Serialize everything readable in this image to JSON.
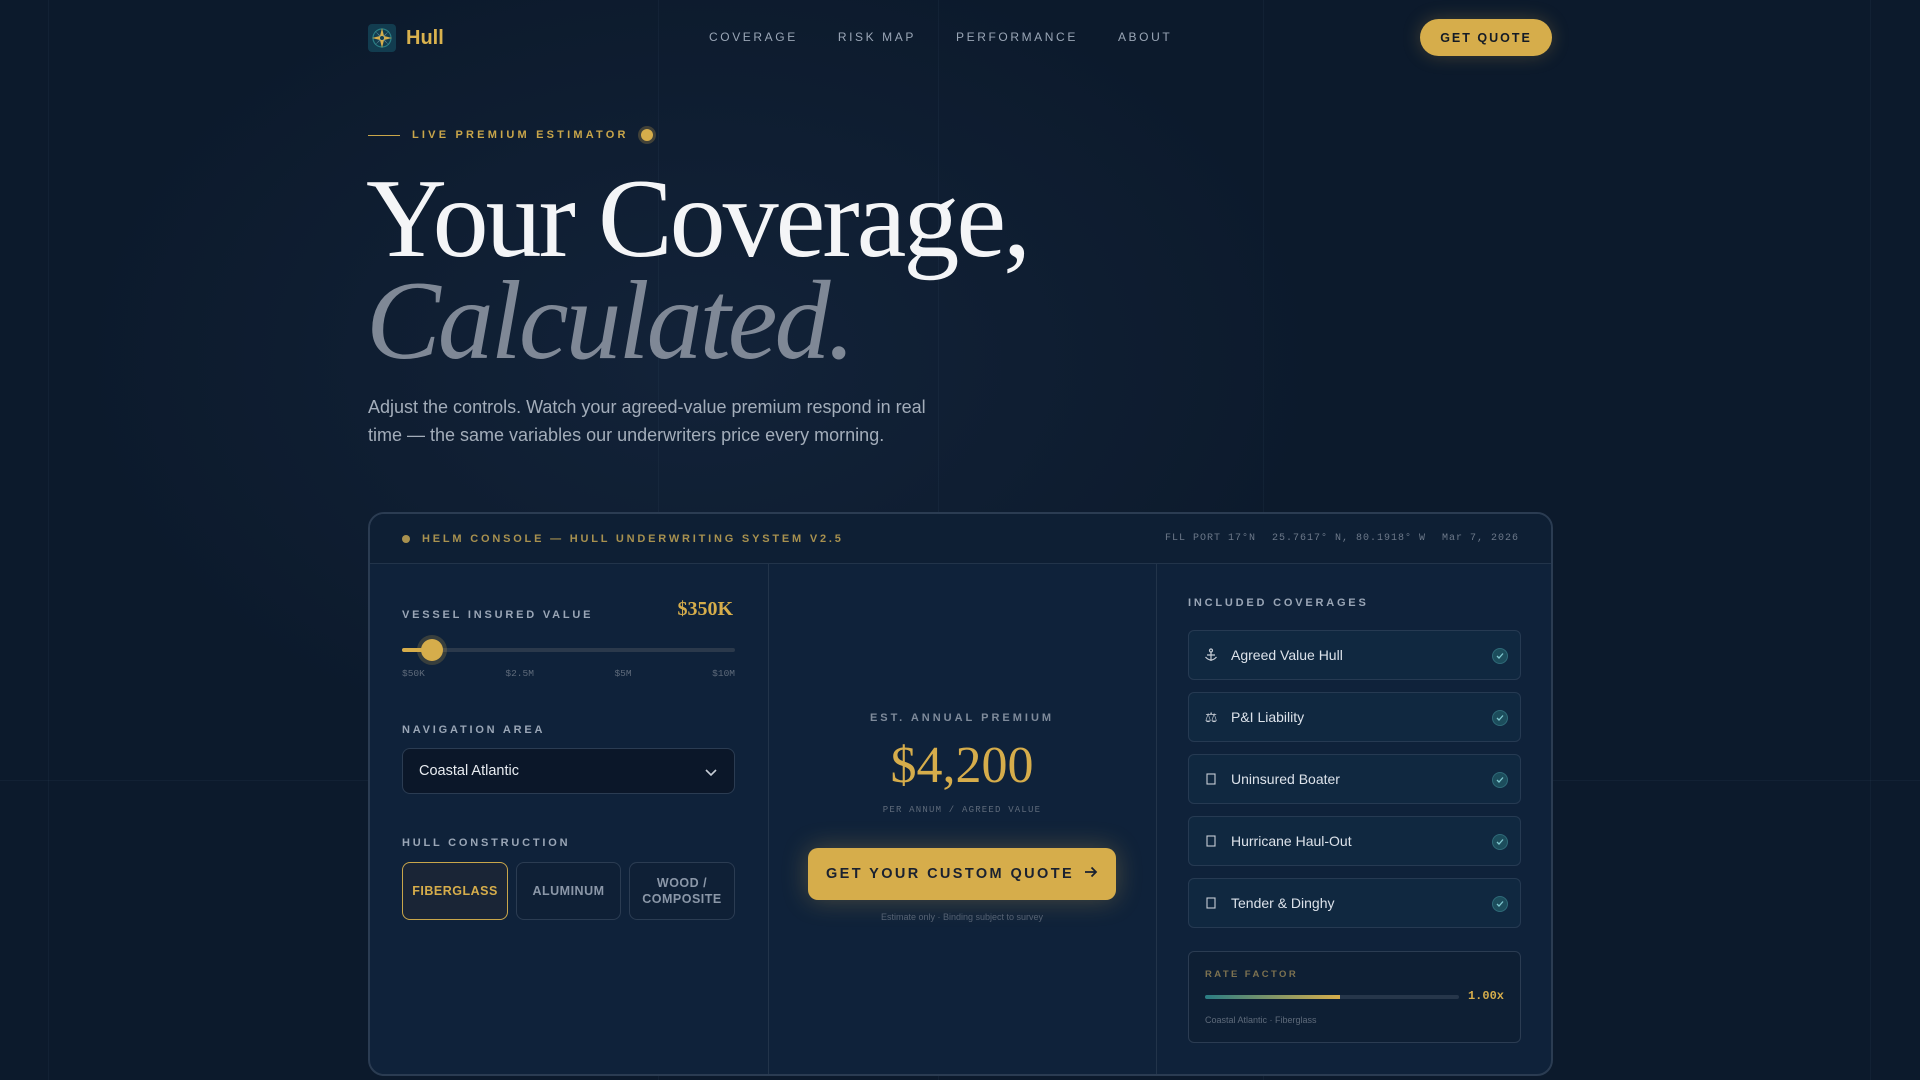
{
  "brand": {
    "name": "Hull"
  },
  "nav": {
    "links": [
      "COVERAGE",
      "RISK MAP",
      "PERFORMANCE",
      "ABOUT"
    ],
    "cta": "GET QUOTE"
  },
  "hero": {
    "eyebrow": "LIVE PREMIUM ESTIMATOR",
    "title_line1": "Your Coverage,",
    "title_line2": "Calculated.",
    "subtitle": "Adjust the controls. Watch your agreed-value premium respond in real time — the same variables our underwriters price every morning."
  },
  "console": {
    "title": "HELM CONSOLE — HULL UNDERWRITING SYSTEM V2.5",
    "meta": [
      "FLL PORT 17°N",
      "25.7617° N, 80.1918° W",
      "Mar 7, 2026"
    ],
    "vessel": {
      "label": "VESSEL INSURED VALUE",
      "value": "$350K",
      "slider_fraction": 0.06,
      "ticks": [
        "$50K",
        "$2.5M",
        "$5M",
        "$10M"
      ]
    },
    "navigation": {
      "label": "NAVIGATION AREA",
      "selected": "Coastal Atlantic"
    },
    "hull": {
      "label": "HULL CONSTRUCTION",
      "options": [
        "FIBERGLASS",
        "ALUMINUM",
        "WOOD / COMPOSITE"
      ],
      "active_index": 0
    },
    "premium": {
      "label": "EST. ANNUAL PREMIUM",
      "amount": "$4,200",
      "sub": "PER ANNUM / AGREED VALUE",
      "cta": "GET YOUR CUSTOM QUOTE",
      "disclaimer": "Estimate only · Binding subject to survey"
    },
    "coverages": {
      "label": "INCLUDED COVERAGES",
      "items": [
        {
          "label": "Agreed Value Hull",
          "icon": "anchor-icon"
        },
        {
          "label": "P&I Liability",
          "icon": "scales-icon"
        },
        {
          "label": "Uninsured Boater",
          "icon": "box-icon"
        },
        {
          "label": "Hurricane Haul-Out",
          "icon": "box-icon"
        },
        {
          "label": "Tender & Dinghy",
          "icon": "box-icon"
        }
      ]
    },
    "rate": {
      "label": "RATE FACTOR",
      "value": "1.00x",
      "fill_fraction": 0.53,
      "caption": "Coastal Atlantic · Fiberglass"
    }
  },
  "colors": {
    "accent": "#d6ad4b",
    "background": "#0c1a2c",
    "panel": "#0f223a",
    "teal": "#2a7d84"
  }
}
